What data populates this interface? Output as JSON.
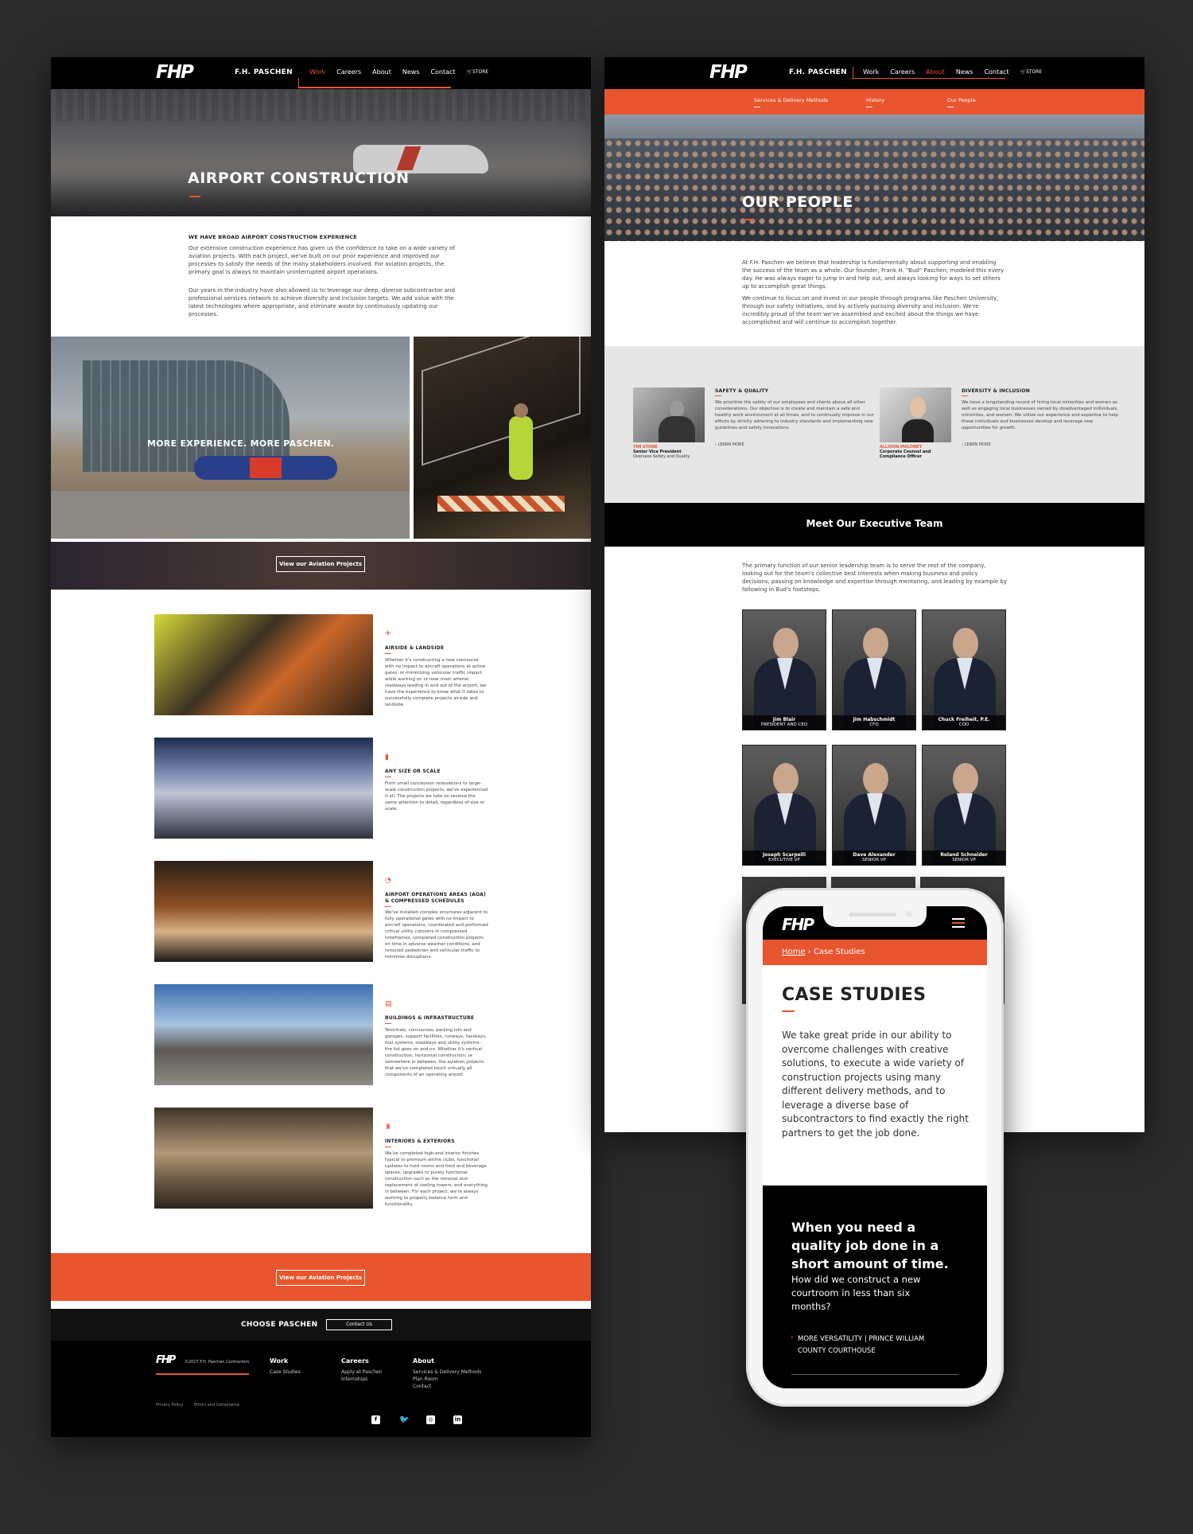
{
  "brand": {
    "logo": "FHP",
    "name": "F.H. PASCHEN"
  },
  "nav": {
    "items": [
      "Work",
      "Careers",
      "About",
      "News",
      "Contact"
    ],
    "store": "STORE"
  },
  "aviation": {
    "hero_title": "AIRPORT CONSTRUCTION",
    "intro_heading": "WE HAVE BROAD AIRPORT CONSTRUCTION EXPERIENCE",
    "intro_p1": "Our extensive construction experience has given us the confidence to take on a wide variety of aviation projects. With each project, we've built on our prior experience and improved our processes to satisfy the needs of the many stakeholders involved. For aviation projects, the primary goal is always to maintain uninterrupted airport operations.",
    "intro_p2": "Our years in the industry have also allowed us to leverage our deep, diverse subcontractor and professional services network to achieve diversity and inclusion targets. We add value with the latest technologies where appropriate, and eliminate waste by continuously updating our processes.",
    "banner_text": "MORE EXPERIENCE. MORE PASCHEN.",
    "cta_label": "View our Aviation Projects",
    "features": [
      {
        "title": "AIRSIDE & LANDSIDE",
        "icon": "plane-icon",
        "text": "Whether it's constructing a new concourse with no impact to aircraft operations at active gates, or minimizing vehicular traffic impact while working on or near main arterial roadways leading in and out of the airport, we have the experience to know what it takes to successfully complete projects airside and landside."
      },
      {
        "title": "ANY SIZE OR SCALE",
        "icon": "scale-icon",
        "text": "From small concession renovations to large-scale construction projects, we've experienced it all. The projects we take on receive the same attention to detail, regardless of size or scale."
      },
      {
        "title": "AIRPORT OPERATIONS AREAS (AOA) & COMPRESSED SCHEDULES",
        "icon": "clock-icon",
        "text": "We've installed complex structures adjacent to fully operational gates with no impact to aircraft operations, coordinated and performed critical utility cutovers in compressed timeframes, completed construction projects on time in adverse weather conditions, and rerouted pedestrian and vehicular traffic to minimize disruptions."
      },
      {
        "title": "BUILDINGS & INFRASTRUCTURE",
        "icon": "building-icon",
        "text": "Terminals, concourses, parking lots and garages, support facilities, runways, taxiways, fuel systems, roadways and utility systems - the list goes on and on. Whether it's vertical construction, horizontal construction, or somewhere in between, the aviation projects that we've completed touch virtually all components of an operating airport."
      },
      {
        "title": "INTERIORS & EXTERIORS",
        "icon": "interior-icon",
        "text": "We've completed high-end interior finishes typical to premium airline clubs, functional updates to hold rooms and food and beverage spaces, upgrades to purely functional construction such as the removal and replacement of cooling towers, and everything in between. For each project, we're always working to properly balance form and functionality."
      }
    ],
    "choose": "CHOOSE PASCHEN",
    "contact_btn": "Contact Us",
    "footer": {
      "copyright": "©2017 F.H. Paschen Contractors",
      "cols": [
        {
          "h": "Work",
          "items": [
            "Case Studies"
          ]
        },
        {
          "h": "Careers",
          "items": [
            "Apply at Paschen",
            "Internships"
          ]
        },
        {
          "h": "About",
          "items": [
            "Services & Delivery Methods",
            "Plan Room",
            "Contact"
          ]
        }
      ],
      "privacy": "Privacy Policy",
      "ethics": "Ethics and Compliance"
    }
  },
  "people": {
    "subnav": [
      "Services & Delivery Methods",
      "History",
      "Our People"
    ],
    "hero_title": "OUR PEOPLE",
    "p1": "At F.H. Paschen we believe that leadership is fundamentally about supporting and enabling the success of the team as a whole. Our founder, Frank H. \"Bud\" Paschen, modeled this every day. He was always eager to jump in and help out, and always looking for ways to set others up to accomplish great things.",
    "p2": "We continue to focus on and invest in our people through programs like Paschen University, through our safety initiatives, and by actively pursuing diversity and inclusion. We're incredibly proud of the team we've assembled and excited about the things we have accomplished and will continue to accomplish together.",
    "cards": [
      {
        "title": "SAFETY & QUALITY",
        "text": "We prioritize the safety of our employees and clients above all other considerations. Our objective is to create and maintain a safe and healthy work environment at all times, and to continually improve in our efforts by strictly adhering to industry standards and implementing new guidelines and safety innovations.",
        "name": "TIM STONE",
        "role": "Senior Vice President",
        "role2": "Oversees Safety and Quality",
        "link": "LEARN MORE"
      },
      {
        "title": "DIVERSITY & INCLUSION",
        "text": "We have a longstanding record of hiring local minorities and women as well as engaging local businesses owned by disadvantaged individuals, minorities, and women. We utilize our experience and expertise to help these individuals and businesses develop and leverage new opportunities for growth.",
        "name": "ALLISON MALONEY",
        "role": "Corporate Counsel and",
        "role2": "Compliance Officer",
        "link": "LEARN MORE"
      }
    ],
    "exec_heading": "Meet Our Executive Team",
    "exec_intro": "The primary function of our senior leadership team is to serve the rest of the company, looking out for the team's collective best interests when making business and policy decisions, passing on knowledge and expertise through mentoring, and leading by example by following in Bud's footsteps.",
    "execs": [
      {
        "name": "Jim Blair",
        "title": "PRESIDENT AND CEO"
      },
      {
        "name": "Jim Habschmidt",
        "title": "CFO"
      },
      {
        "name": "Chuck Freiheit, P.E.",
        "title": "COO"
      },
      {
        "name": "Joseph Scarpelli",
        "title": "EXECUTIVE VP"
      },
      {
        "name": "Dave Alexander",
        "title": "SENIOR VP"
      },
      {
        "name": "Roland Schneider",
        "title": "SENIOR VP"
      }
    ]
  },
  "mobile": {
    "breadcrumb_home": "Home",
    "breadcrumb_sep": "›",
    "breadcrumb_current": "Case Studies",
    "title": "CASE STUDIES",
    "body": "We take great pride in our ability to overcome challenges with creative solutions, to execute a wide variety of construction projects using many different delivery methods, and to leverage a diverse base of subcontractors to find exactly the right partners to get the job done.",
    "promo_heading": "When you need a quality job done in a short amount of time.",
    "promo_sub": "How did we construct a new courtroom in less than six months?",
    "promo_link": "MORE VERSATILITY | PRINCE WILLIAM COUNTY COURTHOUSE"
  },
  "colors": {
    "accent": "#e8552e",
    "dark": "#000000",
    "background": "#2b2b2b"
  }
}
